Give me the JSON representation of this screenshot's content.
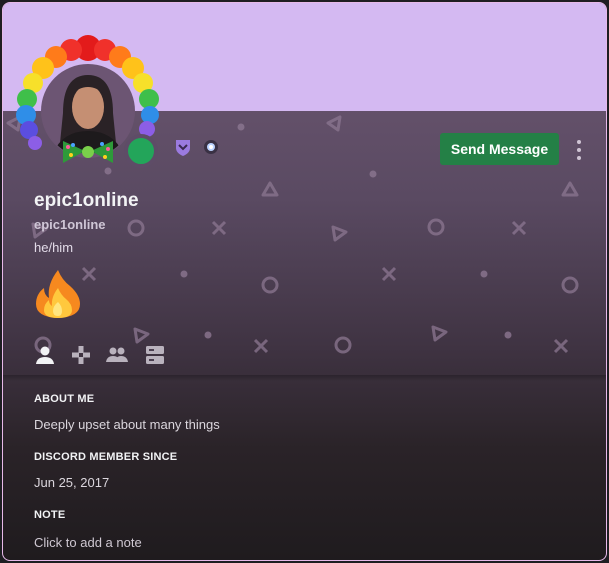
{
  "colors": {
    "banner": "#d4b9f2",
    "accent_green": "#248046",
    "status_online": "#23a55a",
    "badge_purple": "#9b7be0"
  },
  "header": {
    "send_message_label": "Send Message",
    "more_icon": "more-vertical-icon",
    "status": "online",
    "badges": [
      "hypesquad-shield-icon",
      "orb-badge-icon"
    ]
  },
  "profile": {
    "display_name": "epic1online",
    "username": "epic1online",
    "pronouns": "he/him",
    "status_emoji": "fire-icon"
  },
  "tabs": [
    {
      "icon": "user-icon",
      "selected": true
    },
    {
      "icon": "gamepad-icon",
      "selected": false
    },
    {
      "icon": "friends-icon",
      "selected": false
    },
    {
      "icon": "servers-icon",
      "selected": false
    }
  ],
  "about": {
    "title": "ABOUT ME",
    "text": "Deeply upset about many things"
  },
  "member_since": {
    "title": "DISCORD MEMBER SINCE",
    "date": "Jun 25, 2017"
  },
  "note": {
    "title": "NOTE",
    "placeholder": "Click to add a note"
  }
}
